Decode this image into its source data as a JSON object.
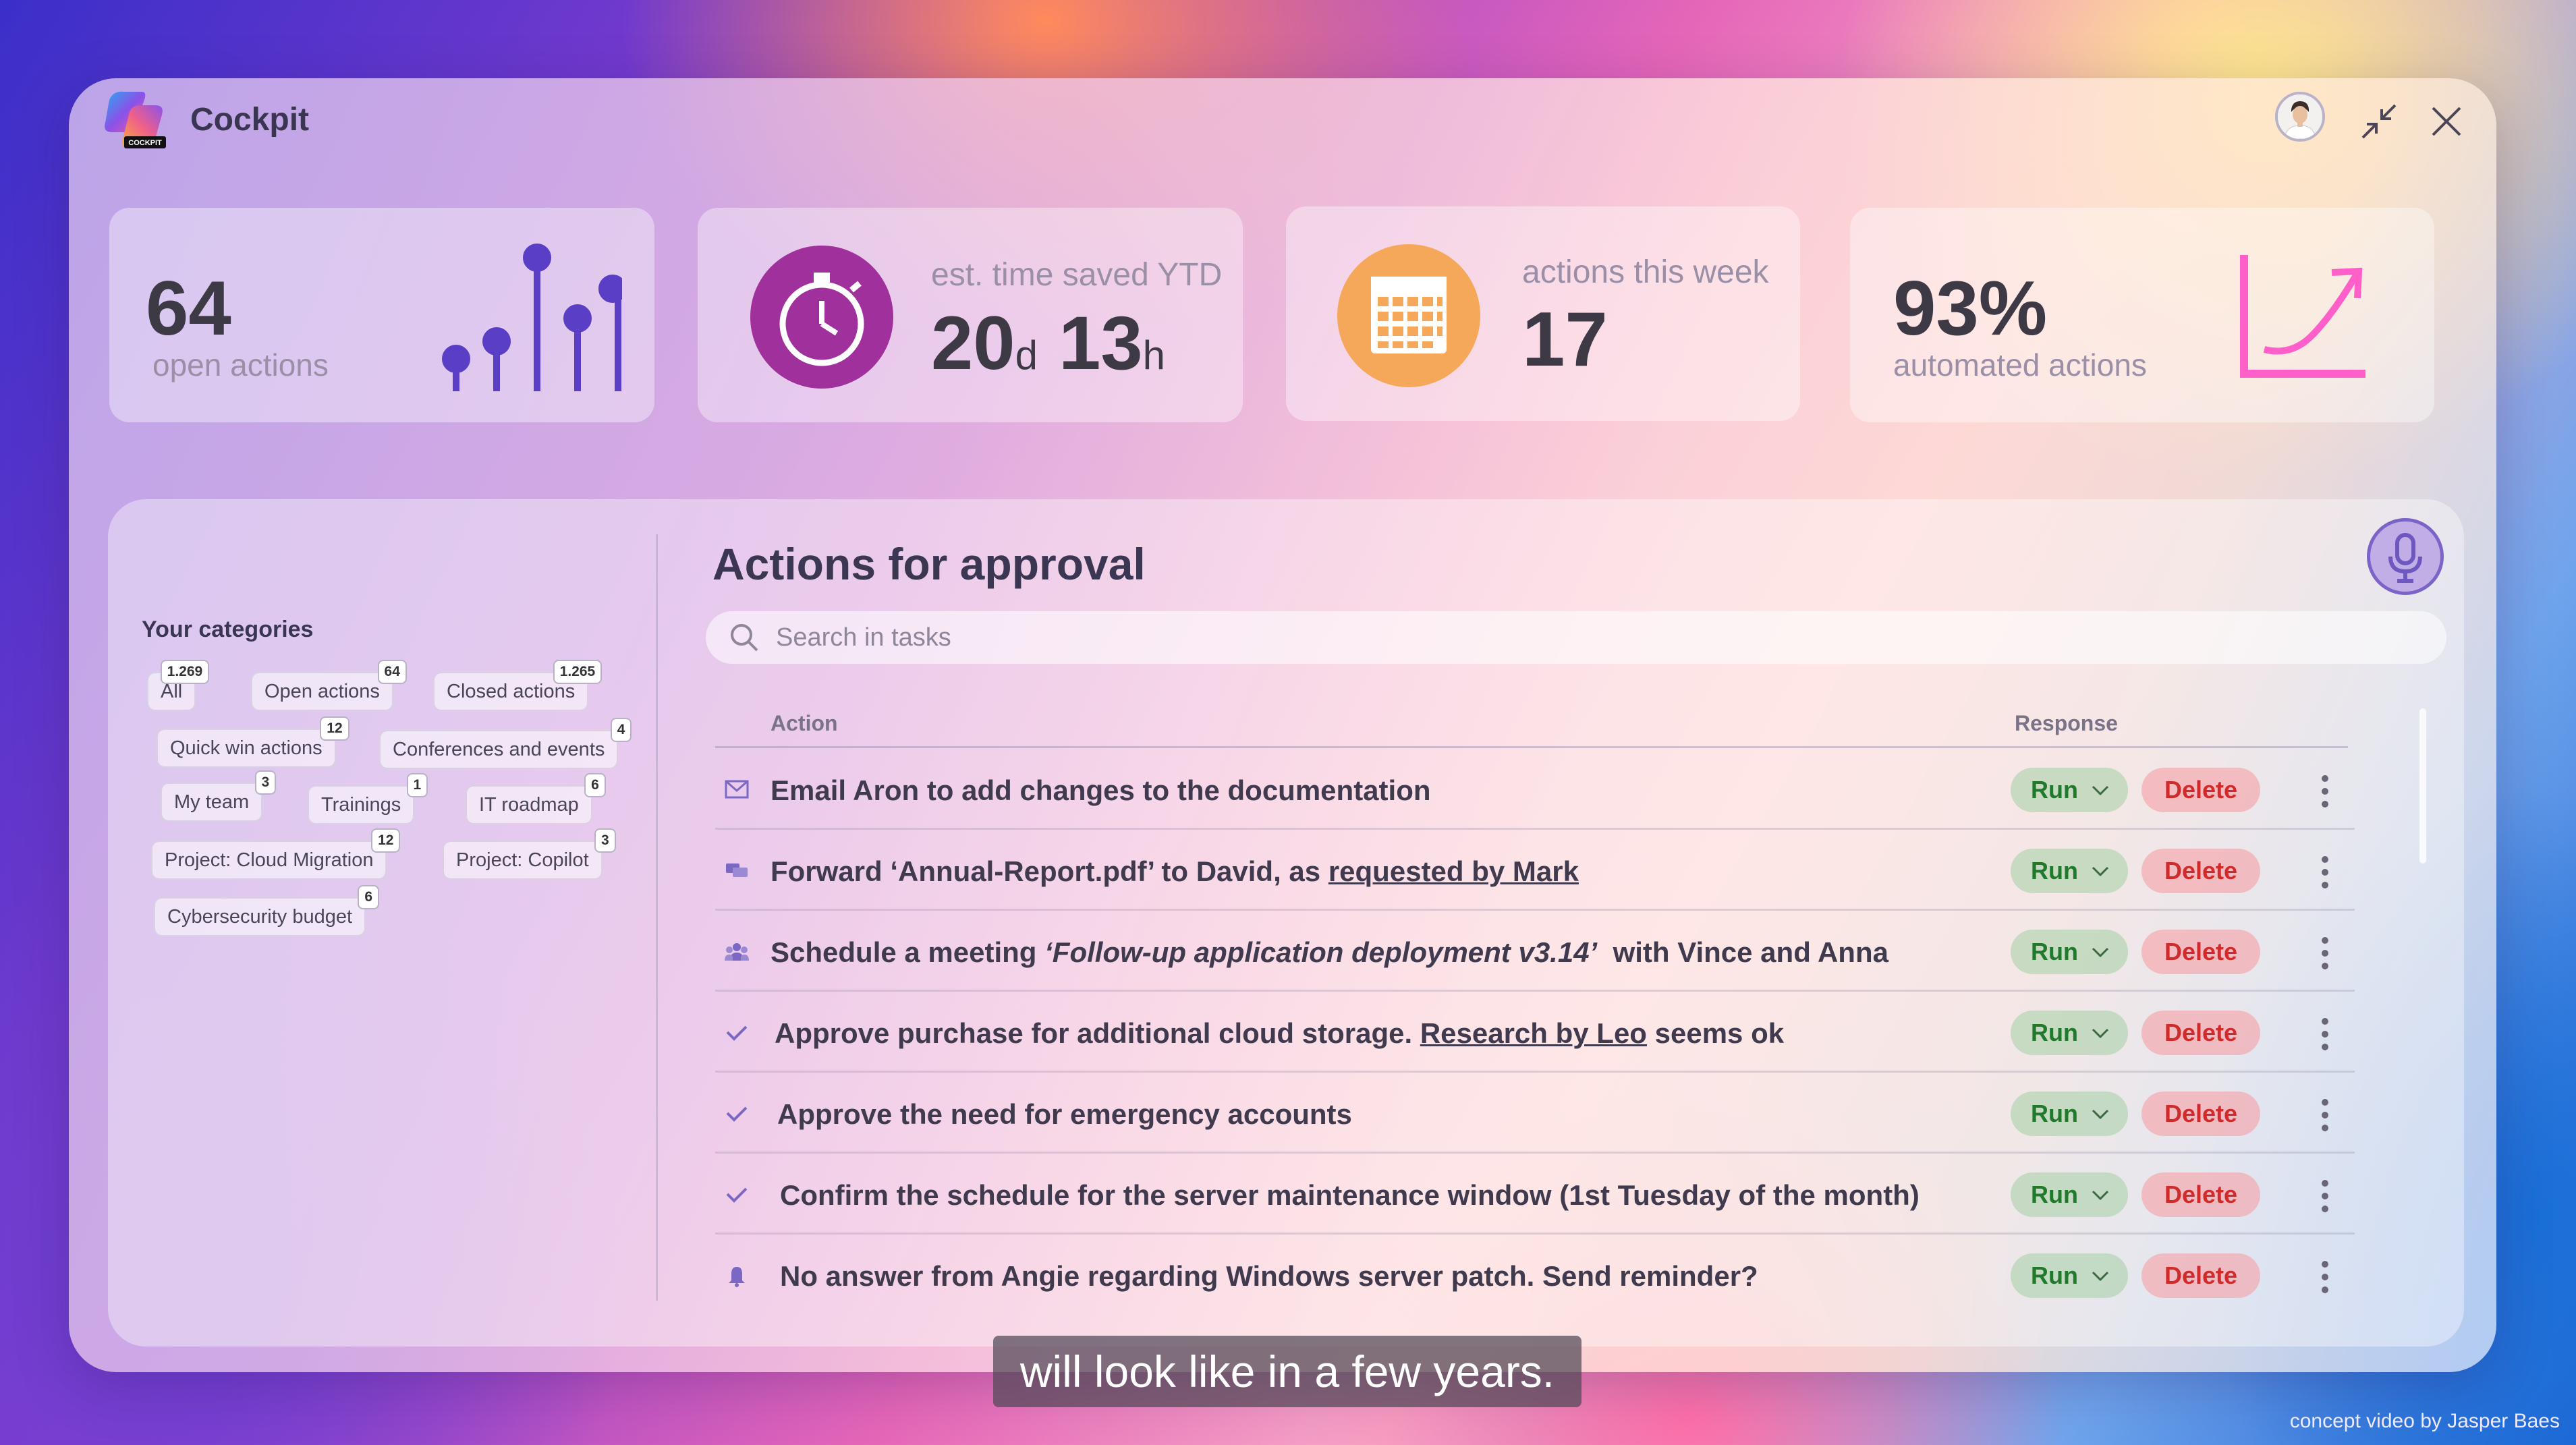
{
  "app": {
    "title": "Cockpit",
    "logo_badge": "COCKPIT"
  },
  "header": {
    "avatar_icon": "user-avatar",
    "minimize_icon": "collapse-arrows-icon",
    "close_icon": "close-icon"
  },
  "stats": {
    "open_actions": {
      "value": "64",
      "label": "open actions",
      "icon": "lollipop-bars-icon"
    },
    "time_saved": {
      "label": "est. time saved YTD",
      "days": "20",
      "days_unit": "d",
      "hours": "13",
      "hours_unit": "h",
      "icon": "stopwatch-icon",
      "color": "#a0309c"
    },
    "actions_week": {
      "label": "actions this week",
      "value": "17",
      "icon": "calendar-icon",
      "color": "#f6a85a"
    },
    "automated": {
      "value": "93%",
      "label": "automated actions",
      "icon": "trend-up-chart-icon",
      "color": "#ff5fc8"
    }
  },
  "categories": {
    "title": "Your categories",
    "items": [
      {
        "label": "All",
        "count": "1.269"
      },
      {
        "label": "Open actions",
        "count": "64"
      },
      {
        "label": "Closed actions",
        "count": "1.265"
      },
      {
        "label": "Quick win actions",
        "count": "12"
      },
      {
        "label": "Conferences and events",
        "count": "4"
      },
      {
        "label": "My team",
        "count": "3"
      },
      {
        "label": "Trainings",
        "count": "1"
      },
      {
        "label": "IT roadmap",
        "count": "6"
      },
      {
        "label": "Project: Cloud Migration",
        "count": "12"
      },
      {
        "label": "Project: Copilot",
        "count": "3"
      },
      {
        "label": "Cybersecurity budget",
        "count": "6"
      }
    ]
  },
  "main": {
    "title": "Actions for approval",
    "search_placeholder": "Search in tasks",
    "col_action": "Action",
    "col_response": "Response",
    "run_label": "Run",
    "delete_label": "Delete",
    "rows": [
      {
        "icon": "envelope-icon",
        "parts": [
          "Email Aron to add changes to the documentation"
        ]
      },
      {
        "icon": "chat-icon",
        "parts": [
          "Forward ‘Annual-Report.pdf’ to David, as ",
          "requested by Mark",
          ""
        ]
      },
      {
        "icon": "people-icon",
        "parts": [
          "Schedule a meeting ",
          "‘Follow-up application deployment v3.14’",
          "  with Vince and Anna"
        ]
      },
      {
        "icon": "checkmark-icon",
        "parts": [
          "Approve purchase for additional cloud storage. ",
          "Research by Leo",
          " seems ok"
        ]
      },
      {
        "icon": "checkmark-icon",
        "parts": [
          "Approve the need for emergency accounts"
        ]
      },
      {
        "icon": "checkmark-icon",
        "parts": [
          "Confirm the schedule for the server maintenance window (1st Tuesday of the month)"
        ]
      },
      {
        "icon": "bell-icon",
        "parts": [
          "No answer from Angie regarding Windows server patch. Send reminder?"
        ]
      }
    ]
  },
  "overlay": {
    "caption": "will look like in a few years.",
    "credit": "concept video by Jasper Baes"
  }
}
